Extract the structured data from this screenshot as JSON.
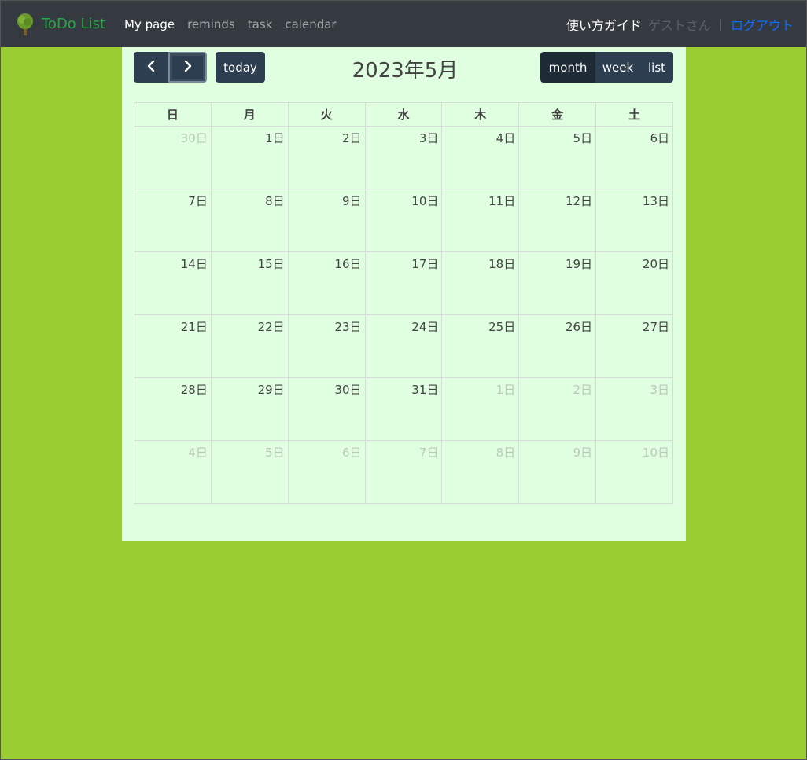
{
  "navbar": {
    "brand": "ToDo List",
    "links": [
      "My page",
      "reminds",
      "task",
      "calendar"
    ],
    "guide": "使い方ガイド",
    "user": "ゲストさん",
    "separator": "|",
    "logout": "ログアウト"
  },
  "toolbar": {
    "prev_icon": "‹",
    "next_icon": "›",
    "today": "today",
    "title": "2023年5月",
    "views": [
      "month",
      "week",
      "list"
    ],
    "active_view": "month"
  },
  "calendar": {
    "weekdays": [
      "日",
      "月",
      "火",
      "水",
      "木",
      "金",
      "土"
    ],
    "weeks": [
      [
        {
          "d": "30日",
          "o": true
        },
        {
          "d": "1日",
          "o": false
        },
        {
          "d": "2日",
          "o": false
        },
        {
          "d": "3日",
          "o": false
        },
        {
          "d": "4日",
          "o": false
        },
        {
          "d": "5日",
          "o": false
        },
        {
          "d": "6日",
          "o": false
        }
      ],
      [
        {
          "d": "7日",
          "o": false
        },
        {
          "d": "8日",
          "o": false
        },
        {
          "d": "9日",
          "o": false
        },
        {
          "d": "10日",
          "o": false
        },
        {
          "d": "11日",
          "o": false
        },
        {
          "d": "12日",
          "o": false
        },
        {
          "d": "13日",
          "o": false
        }
      ],
      [
        {
          "d": "14日",
          "o": false
        },
        {
          "d": "15日",
          "o": false
        },
        {
          "d": "16日",
          "o": false
        },
        {
          "d": "17日",
          "o": false
        },
        {
          "d": "18日",
          "o": false
        },
        {
          "d": "19日",
          "o": false
        },
        {
          "d": "20日",
          "o": false
        }
      ],
      [
        {
          "d": "21日",
          "o": false
        },
        {
          "d": "22日",
          "o": false
        },
        {
          "d": "23日",
          "o": false
        },
        {
          "d": "24日",
          "o": false
        },
        {
          "d": "25日",
          "o": false
        },
        {
          "d": "26日",
          "o": false
        },
        {
          "d": "27日",
          "o": false
        }
      ],
      [
        {
          "d": "28日",
          "o": false
        },
        {
          "d": "29日",
          "o": false
        },
        {
          "d": "30日",
          "o": false
        },
        {
          "d": "31日",
          "o": false
        },
        {
          "d": "1日",
          "o": true
        },
        {
          "d": "2日",
          "o": true
        },
        {
          "d": "3日",
          "o": true
        }
      ],
      [
        {
          "d": "4日",
          "o": true
        },
        {
          "d": "5日",
          "o": true
        },
        {
          "d": "6日",
          "o": true
        },
        {
          "d": "7日",
          "o": true
        },
        {
          "d": "8日",
          "o": true
        },
        {
          "d": "9日",
          "o": true
        },
        {
          "d": "10日",
          "o": true
        }
      ]
    ]
  },
  "colors": {
    "page_bg": "#9acd32",
    "navbar_bg": "#343a40",
    "content_bg": "#e0ffe0",
    "brand": "#28a745",
    "button_bg": "#2c3e50",
    "logout": "#0d6efd"
  },
  "icons": {
    "brand": "tree-icon",
    "prev": "chevron-left-icon",
    "next": "chevron-right-icon"
  }
}
